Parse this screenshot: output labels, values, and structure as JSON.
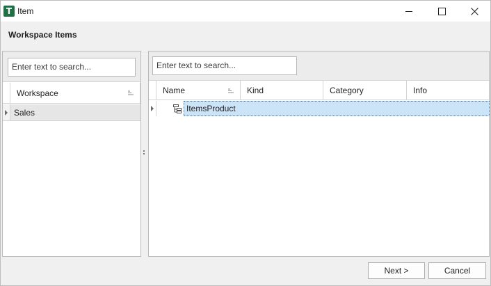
{
  "window": {
    "app_icon_letter": "T",
    "title": "Item"
  },
  "heading": "Workspace Items",
  "left_panel": {
    "search_placeholder": "Enter text to search...",
    "columns": [
      "Workspace"
    ],
    "rows": [
      {
        "workspace": "Sales"
      }
    ]
  },
  "right_panel": {
    "search_placeholder": "Enter text to search...",
    "columns": [
      "Name",
      "Kind",
      "Category",
      "Info"
    ],
    "rows": [
      {
        "name": "ItemsProduct",
        "kind": "",
        "category": "",
        "info": ""
      }
    ]
  },
  "buttons": {
    "next": "Next >",
    "cancel": "Cancel"
  },
  "colors": {
    "app_icon": "#1e7145",
    "selection": "#cce4f7",
    "selected_left_row": "#e6e6e6"
  }
}
